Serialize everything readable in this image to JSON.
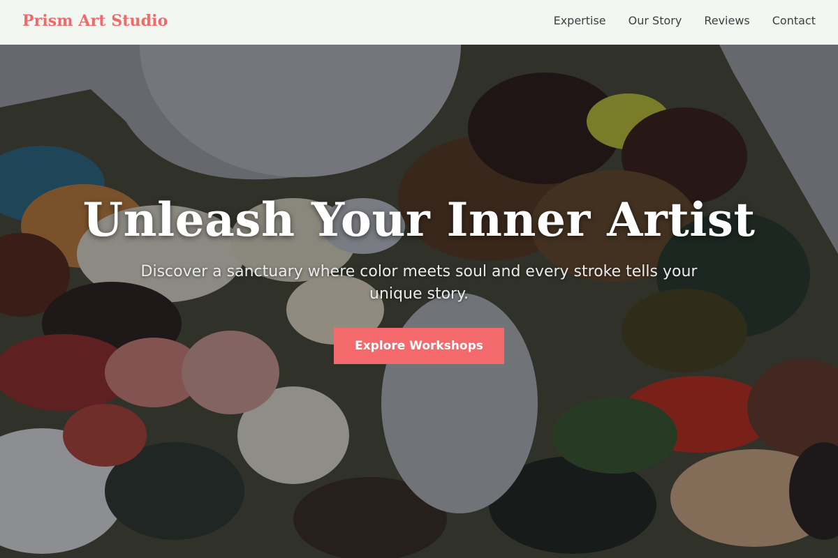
{
  "header": {
    "brand": "Prism Art Studio",
    "nav": [
      {
        "label": "Expertise"
      },
      {
        "label": "Our Story"
      },
      {
        "label": "Reviews"
      },
      {
        "label": "Contact"
      }
    ]
  },
  "hero": {
    "title": "Unleash Your Inner Artist",
    "subtitle": "Discover a sanctuary where color meets soul and every stroke tells your unique story.",
    "cta_label": "Explore Workshops"
  },
  "colors": {
    "brand": "#f06a6b",
    "cta": "#f46a6c",
    "header_bg": "#f3f7f1",
    "nav_text": "#3d3f43"
  }
}
